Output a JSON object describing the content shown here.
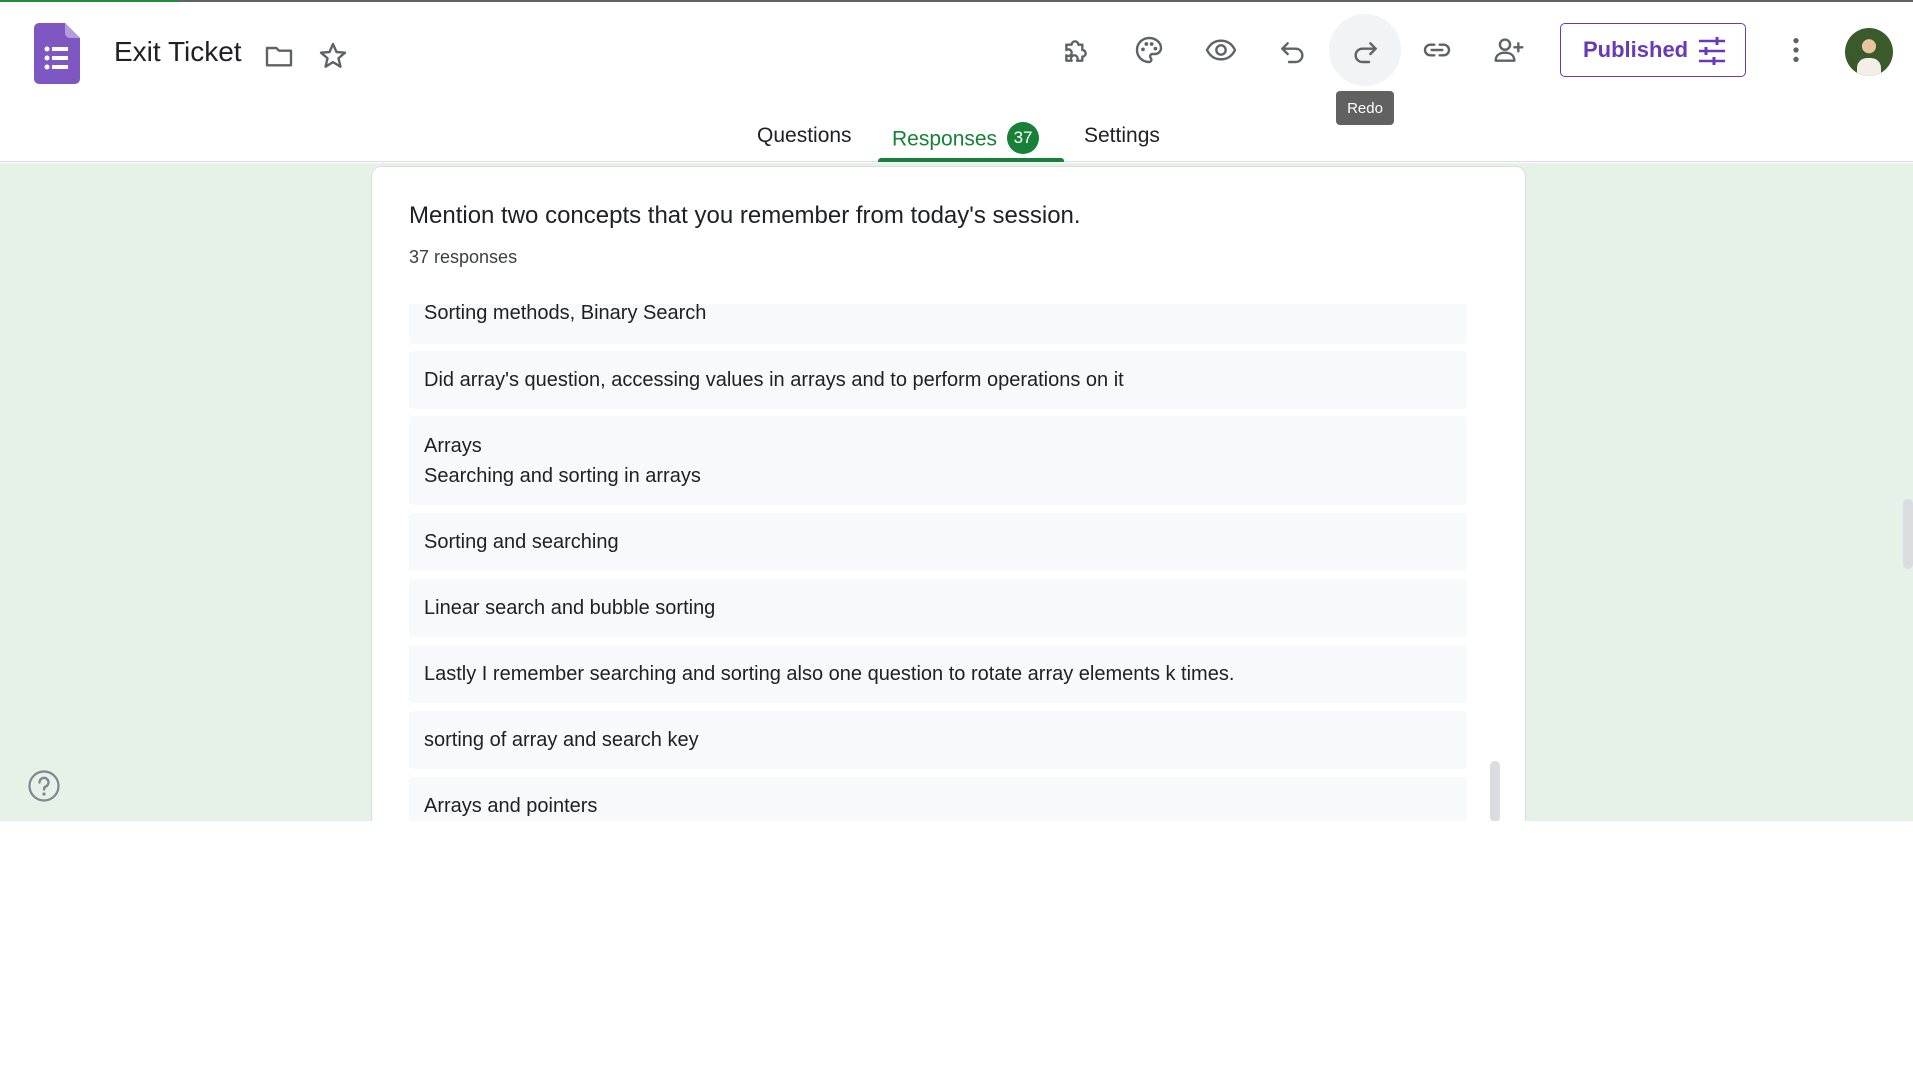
{
  "app": {
    "title": "Exit Ticket",
    "publish_label": "Published",
    "tooltip": "Redo"
  },
  "tabs": {
    "questions": "Questions",
    "responses": "Responses",
    "responses_count": "37",
    "settings": "Settings"
  },
  "question": {
    "title": "Mention two concepts that you remember from today's session.",
    "count": "37 responses"
  },
  "responses": [
    "Sorting methods, Binary Search",
    "Did array's question, accessing values in arrays and to perform operations on it",
    "Arrays\nSearching and sorting in arrays",
    "Sorting and searching",
    "Linear search and bubble sorting",
    "Lastly I remember searching and sorting also one question to rotate array elements k times.",
    "sorting of array and search key",
    "Arrays and pointers"
  ],
  "colors": {
    "brand_purple": "#673ab7",
    "forms_logo": "#7e57c2",
    "accent_green": "#188038",
    "page_bg": "#e6f2e8"
  },
  "icons": [
    "forms-logo-icon",
    "folder-icon",
    "star-icon",
    "add-ons-icon",
    "palette-icon",
    "preview-icon",
    "undo-icon",
    "redo-icon",
    "link-icon",
    "add-collaborator-icon",
    "publish-settings-icon",
    "more-vert-icon",
    "help-icon"
  ]
}
